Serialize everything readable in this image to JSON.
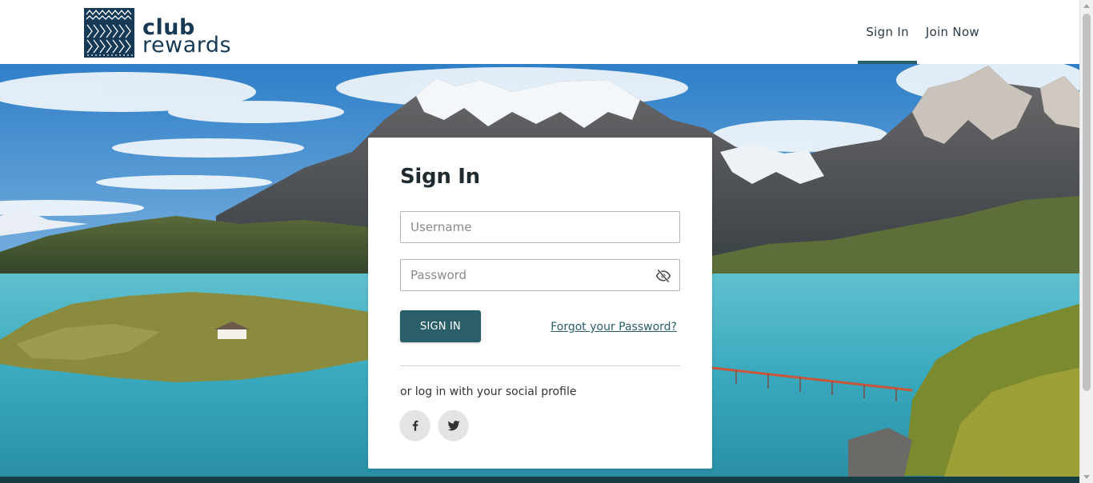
{
  "brand": {
    "name_line1": "club",
    "name_line2": "rewards",
    "logo_icon": "patterned-square-logo-icon",
    "color": "#163a55"
  },
  "nav": {
    "items": [
      {
        "label": "Sign In",
        "active": true
      },
      {
        "label": "Join Now",
        "active": false
      }
    ],
    "accent_color": "#2a5f6a"
  },
  "hero": {
    "image": "mountain-lake-landscape"
  },
  "signin": {
    "title": "Sign In",
    "username_placeholder": "Username",
    "username_value": "",
    "password_placeholder": "Password",
    "password_value": "",
    "password_toggle_icon": "eye-slash-icon",
    "submit_label": "SIGN IN",
    "forgot_label": "Forgot your Password?",
    "social_prompt": "or log in with your social profile",
    "social": [
      {
        "icon": "facebook-icon"
      },
      {
        "icon": "twitter-icon"
      }
    ],
    "button_color": "#2a5f6a"
  }
}
